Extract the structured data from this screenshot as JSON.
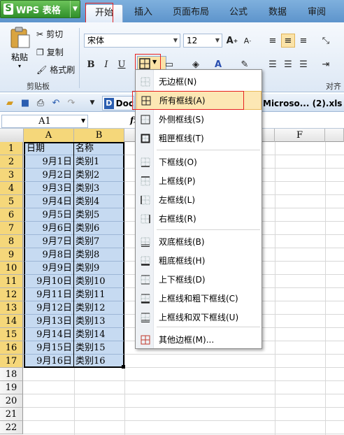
{
  "app": {
    "name": "WPS 表格",
    "logo": "S"
  },
  "tabs": [
    "开始",
    "插入",
    "页面布局",
    "公式",
    "数据",
    "审阅"
  ],
  "ribbon": {
    "paste": "粘贴",
    "cut": "剪切",
    "copy": "复制",
    "format_painter": "格式刷",
    "clipboard_group": "剪贴板",
    "font_name": "宋体",
    "font_size": "12",
    "align_group": "对齐"
  },
  "doc_tabs": {
    "doc_short": "Doc",
    "file": "Microso... (2).xls *"
  },
  "formula_bar": {
    "name_box": "A1",
    "fx": "fx"
  },
  "columns": [
    "A",
    "B",
    "F"
  ],
  "rows": [
    "1",
    "2",
    "3",
    "4",
    "5",
    "6",
    "7",
    "8",
    "9",
    "10",
    "11",
    "12",
    "13",
    "14",
    "15",
    "16",
    "17",
    "18",
    "19",
    "20",
    "21",
    "22"
  ],
  "cells": {
    "header": [
      "日期",
      "名称"
    ],
    "data": [
      [
        "9月1日",
        "类别1"
      ],
      [
        "9月2日",
        "类别2"
      ],
      [
        "9月3日",
        "类别3"
      ],
      [
        "9月4日",
        "类别4"
      ],
      [
        "9月5日",
        "类别5"
      ],
      [
        "9月6日",
        "类别6"
      ],
      [
        "9月7日",
        "类别7"
      ],
      [
        "9月8日",
        "类别8"
      ],
      [
        "9月9日",
        "类别9"
      ],
      [
        "9月10日",
        "类别10"
      ],
      [
        "9月11日",
        "类别11"
      ],
      [
        "9月12日",
        "类别12"
      ],
      [
        "9月13日",
        "类别13"
      ],
      [
        "9月14日",
        "类别14"
      ],
      [
        "9月15日",
        "类别15"
      ],
      [
        "9月16日",
        "类别16"
      ]
    ]
  },
  "border_menu": {
    "items": [
      {
        "label": "无边框(N)",
        "icon": "no-border-icon"
      },
      {
        "label": "所有框线(A)",
        "icon": "all-borders-icon",
        "highlighted": true
      },
      {
        "label": "外侧框线(S)",
        "icon": "outside-borders-icon"
      },
      {
        "label": "粗匣框线(T)",
        "icon": "thick-box-border-icon"
      },
      {
        "label": "下框线(O)",
        "icon": "bottom-border-icon"
      },
      {
        "label": "上框线(P)",
        "icon": "top-border-icon"
      },
      {
        "label": "左框线(L)",
        "icon": "left-border-icon"
      },
      {
        "label": "右框线(R)",
        "icon": "right-border-icon"
      },
      {
        "label": "双底框线(B)",
        "icon": "double-bottom-border-icon"
      },
      {
        "label": "粗底框线(H)",
        "icon": "thick-bottom-border-icon"
      },
      {
        "label": "上下框线(D)",
        "icon": "top-bottom-border-icon"
      },
      {
        "label": "上框线和粗下框线(C)",
        "icon": "top-thick-bottom-border-icon"
      },
      {
        "label": "上框线和双下框线(U)",
        "icon": "top-double-bottom-border-icon"
      },
      {
        "label": "其他边框(M)...",
        "icon": "more-borders-icon"
      }
    ]
  },
  "colors": {
    "highlight_red": "#e62020",
    "selection_fill": "#c6daf1",
    "header_selected": "#f5d77a",
    "menu_hover": "#fce7b4",
    "wps_green": "#2f8f2a"
  }
}
